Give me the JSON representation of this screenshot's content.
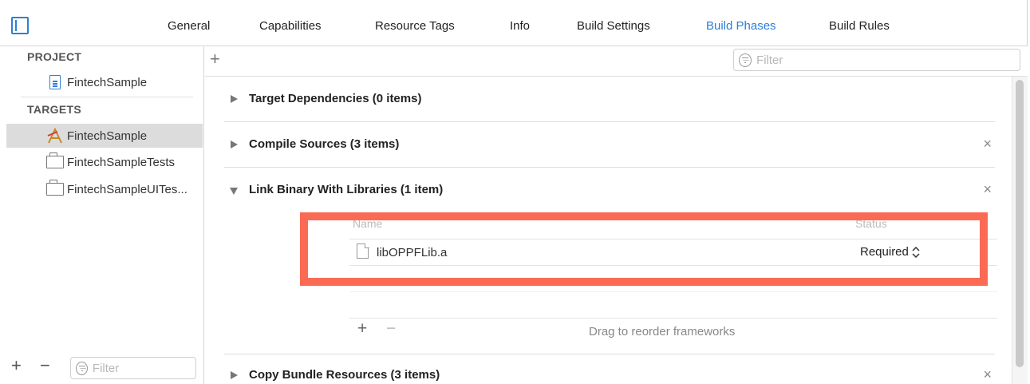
{
  "tabs": [
    {
      "label": "General",
      "active": false
    },
    {
      "label": "Capabilities",
      "active": false
    },
    {
      "label": "Resource Tags",
      "active": false
    },
    {
      "label": "Info",
      "active": false
    },
    {
      "label": "Build Settings",
      "active": false
    },
    {
      "label": "Build Phases",
      "active": true
    },
    {
      "label": "Build Rules",
      "active": false
    }
  ],
  "sidebar": {
    "project_heading": "PROJECT",
    "project_item": "FintechSample",
    "targets_heading": "TARGETS",
    "targets": [
      {
        "label": "FintechSample",
        "selected": true
      },
      {
        "label": "FintechSampleTests",
        "selected": false
      },
      {
        "label": "FintechSampleUITes...",
        "selected": false
      }
    ],
    "add_label": "+",
    "remove_label": "−",
    "filter_placeholder": "Filter"
  },
  "main": {
    "add_label": "+",
    "filter_placeholder": "Filter",
    "phases": [
      {
        "title": "Target Dependencies (0 items)",
        "expanded": false,
        "removable": false
      },
      {
        "title": "Compile Sources (3 items)",
        "expanded": false,
        "removable": true
      },
      {
        "title": "Link Binary With Libraries (1 item)",
        "expanded": true,
        "removable": true
      },
      {
        "title": "Copy Bundle Resources (3 items)",
        "expanded": false,
        "removable": true
      }
    ],
    "close_glyph": "×",
    "libraries": {
      "col_name": "Name",
      "col_status": "Status",
      "rows": [
        {
          "name": "libOPPFLib.a",
          "status": "Required"
        }
      ],
      "add_label": "+",
      "remove_label": "−",
      "hint": "Drag to reorder frameworks"
    }
  },
  "colors": {
    "accent": "#2d7dd9",
    "highlight": "#fb6a55"
  }
}
